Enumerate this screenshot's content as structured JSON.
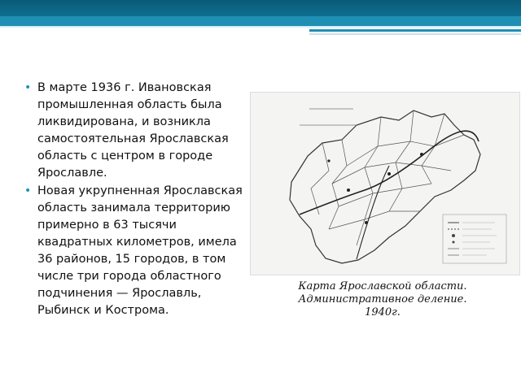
{
  "bullets": [
    "В марте 1936 г. Ивановская промышленная область была ликвидирована, и возникла самостоятельная Ярославская область с центром в городе Ярославле.",
    "Новая укрупненная Ярославская область занимала территорию примерно в 63 тысячи квадратных километров, имела 36 районов, 15 городов, в том числе три города областного подчинения — Ярославль, Рыбинск и Кострома."
  ],
  "caption": {
    "line1": "Карта Ярославской области.",
    "line2": "Административное деление.",
    "line3": "1940г."
  },
  "colors": {
    "header_dark": "#0a5a78",
    "header_accent": "#1f8fb3",
    "bullet": "#1f8fb3"
  }
}
